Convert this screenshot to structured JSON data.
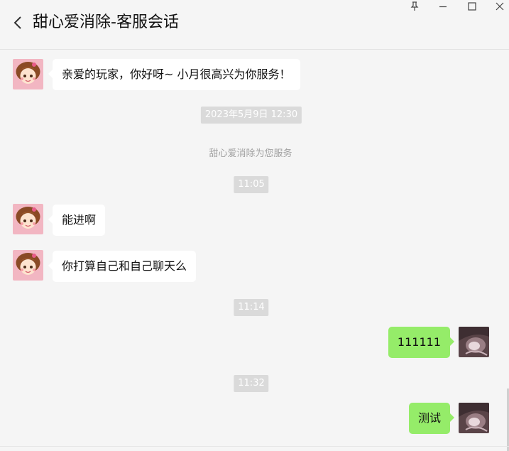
{
  "window": {
    "title": "甜心爱消除-客服会话",
    "controls": [
      "pin-icon",
      "minimize-icon",
      "maximize-icon",
      "close-icon"
    ]
  },
  "colors": {
    "background": "#f5f5f5",
    "bubble_incoming": "#ffffff",
    "bubble_outgoing": "#95ec69",
    "time_pill": "#dadada",
    "system_text": "#a0a0a0"
  },
  "messages": [
    {
      "type": "incoming",
      "text": "亲爱的玩家，你好呀~ 小月很高兴为你服务！",
      "avatar": "service-avatar"
    },
    {
      "type": "timestamp",
      "text": "2023年5月9日 12:30"
    },
    {
      "type": "system",
      "text": "甜心爱消除为您服务"
    },
    {
      "type": "timestamp",
      "text": "11:05"
    },
    {
      "type": "incoming",
      "text": "能进啊",
      "avatar": "service-avatar"
    },
    {
      "type": "incoming",
      "text": "你打算自己和自己聊天么",
      "avatar": "service-avatar"
    },
    {
      "type": "timestamp",
      "text": "11:14"
    },
    {
      "type": "outgoing",
      "text": "111111",
      "avatar": "user-avatar"
    },
    {
      "type": "timestamp",
      "text": "11:32"
    },
    {
      "type": "outgoing",
      "text": "测试",
      "avatar": "user-avatar"
    }
  ]
}
